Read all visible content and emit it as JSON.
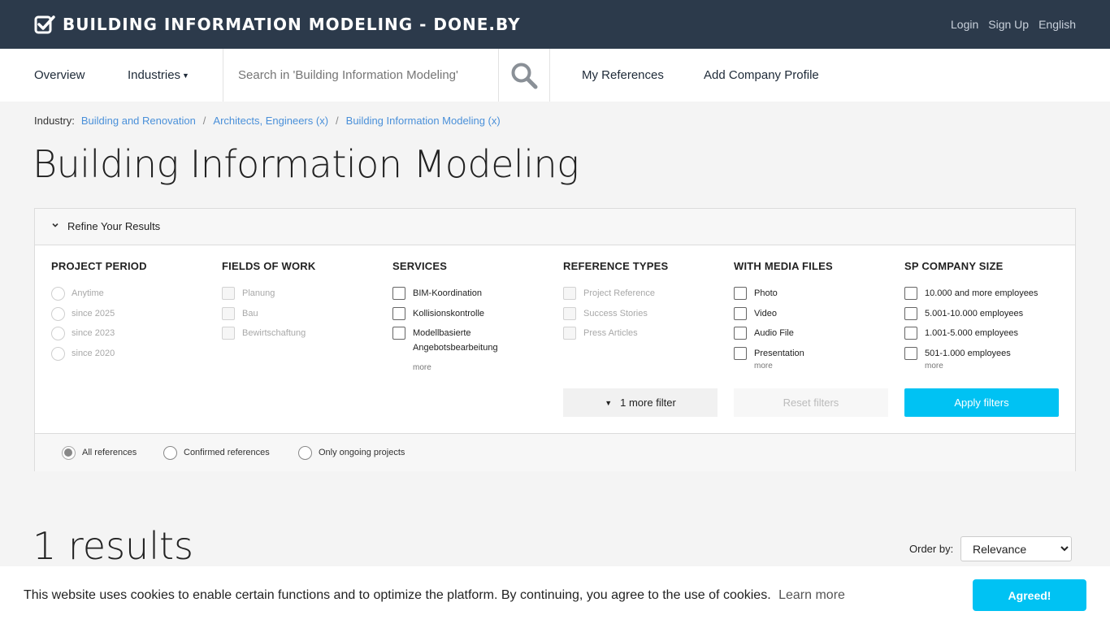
{
  "header": {
    "brand": "BUILDING INFORMATION MODELING - DONE.BY",
    "links": [
      "Login",
      "Sign Up",
      "English"
    ]
  },
  "nav": {
    "overview": "Overview",
    "industries": "Industries",
    "search_placeholder": "Search in 'Building Information Modeling'",
    "my_references": "My References",
    "add_company": "Add Company Profile"
  },
  "breadcrumb": {
    "label": "Industry:",
    "items": [
      "Building and Renovation",
      "Architects, Engineers (x)",
      "Building Information Modeling (x)"
    ],
    "separator": "/"
  },
  "page_title": "Building Information Modeling",
  "filters": {
    "title": "Refine Your Results",
    "columns": [
      {
        "heading": "PROJECT PERIOD",
        "options": [
          "Anytime",
          "since 2025",
          "since 2023",
          "since 2020"
        ]
      },
      {
        "heading": "FIELDS OF WORK",
        "options": [
          "Planung",
          "Bau",
          "Bewirtschaftung"
        ]
      },
      {
        "heading": "SERVICES",
        "options": [
          "BIM-Koordination",
          "Kollisionskontrolle",
          "Modellbasierte Angebotsbearbeitung"
        ],
        "more": "more"
      },
      {
        "heading": "REFERENCE TYPES",
        "options": [
          "Project Reference",
          "Success Stories",
          "Press Articles"
        ]
      },
      {
        "heading": "WITH MEDIA FILES",
        "options": [
          "Photo",
          "Video",
          "Audio File",
          "Presentation"
        ],
        "more": "more"
      },
      {
        "heading": "SP COMPANY SIZE",
        "options": [
          "10.000 and more employees",
          "5.001-10.000 employees",
          "1.001-5.000 employees",
          "501-1.000 employees"
        ],
        "more": "more"
      }
    ],
    "more_filter": "1 more filter",
    "reset": "Reset filters",
    "apply": "Apply filters",
    "footer_options": [
      "All references",
      "Confirmed references",
      "Only ongoing projects"
    ],
    "footer_selected": "All references"
  },
  "results": {
    "count_text": "1 results",
    "order_label": "Order by:",
    "order_value": "Relevance"
  },
  "cookie": {
    "message": "This website uses cookies to enable certain functions and to optimize the platform. By continuing, you agree to the use of cookies.",
    "learn_more": "Learn more",
    "agree": "Agreed!"
  },
  "colors": {
    "header_bg": "#2c3a4b",
    "accent": "#00c2f3",
    "link": "#4a90d9"
  }
}
